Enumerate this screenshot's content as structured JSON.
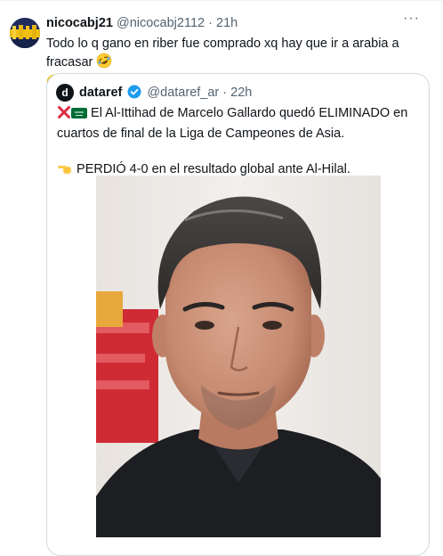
{
  "tweet": {
    "display_name": "nicocabj21",
    "handle": "@nicocabj2112",
    "separator": "·",
    "time": "21h",
    "more_label": "···",
    "text": "Todo lo q gano en riber  fue comprado xq hay  que ir a arabia a fracasar",
    "emojis": [
      "rolling-on-floor-laughing",
      "rolling-on-floor-laughing",
      "rolling-on-floor-laughing"
    ]
  },
  "quote": {
    "avatar_letter": "d",
    "display_name": "dataref",
    "handle": "@dataref_ar",
    "separator": "·",
    "time": "22h",
    "verified_color": "#1d9bf0",
    "line1": "El Al-Ittihad de Marcelo Gallardo quedó ELIMINADO en cuartos de final de la Liga de Campeones de Asia.",
    "line2": "PERDIÓ 4-0 en el resultado global ante Al-Hilal.",
    "line1_icons": [
      "cross-mark",
      "saudi-arabia-flag"
    ],
    "line2_icon": "backhand-index-pointing-left"
  },
  "colors": {
    "accent": "#1d9bf0",
    "muted": "#536471",
    "border": "#cfd9de"
  }
}
